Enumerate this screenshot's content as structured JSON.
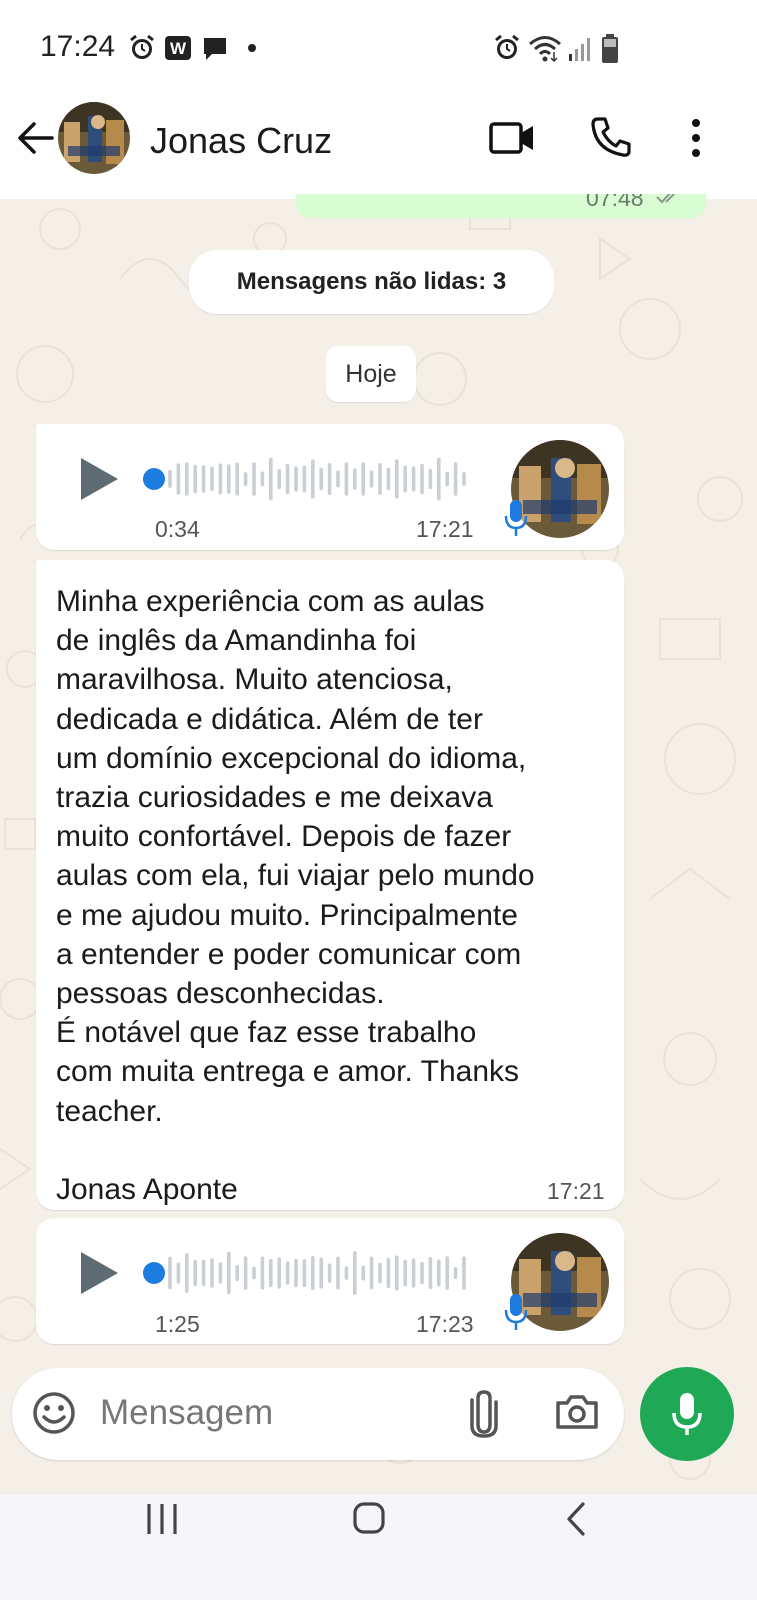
{
  "status_bar": {
    "time": "17:24",
    "left_icons": [
      "alarm-icon",
      "w-app-icon",
      "chat-bubble-icon",
      "dot-icon"
    ],
    "right_icons": [
      "alarm-icon",
      "wifi-icon",
      "signal-icon",
      "battery-icon"
    ]
  },
  "header": {
    "contact_name": "Jonas Cruz",
    "icons": [
      "back-arrow-icon",
      "video-call-icon",
      "phone-icon",
      "more-vert-icon"
    ]
  },
  "chat": {
    "previous_message_time": "07:48",
    "unread_banner": "Mensagens não lidas: 3",
    "date_chip": "Hoje",
    "voice_1": {
      "duration": "0:34",
      "time": "17:21"
    },
    "text_message": {
      "text": "Minha experiência com as aulas\nde inglês da Amandinha foi\nmaravilhosa. Muito atenciosa,\ndedicada e didática. Além de ter\num domínio excepcional do idioma,\ntrazia curiosidades e me deixava\nmuito confortável. Depois de fazer\naulas com ela, fui viajar pelo mundo\ne me ajudou muito. Principalmente\na entender e poder comunicar com\npessoas desconhecidas.\nÉ notável que faz esse trabalho\ncom muita entrega e amor. Thanks\nteacher.\n\nJonas Aponte",
      "time": "17:21"
    },
    "voice_2": {
      "duration": "1:25",
      "time": "17:23"
    }
  },
  "composer": {
    "placeholder": "Mensagem",
    "icons": [
      "emoji-icon",
      "attach-icon",
      "camera-icon",
      "mic-icon"
    ]
  },
  "colors": {
    "accent_green": "#1fa855",
    "mic_blue": "#1e7be0",
    "chat_background": "#f4efe7",
    "outgoing_bubble": "#d9fdd3"
  }
}
